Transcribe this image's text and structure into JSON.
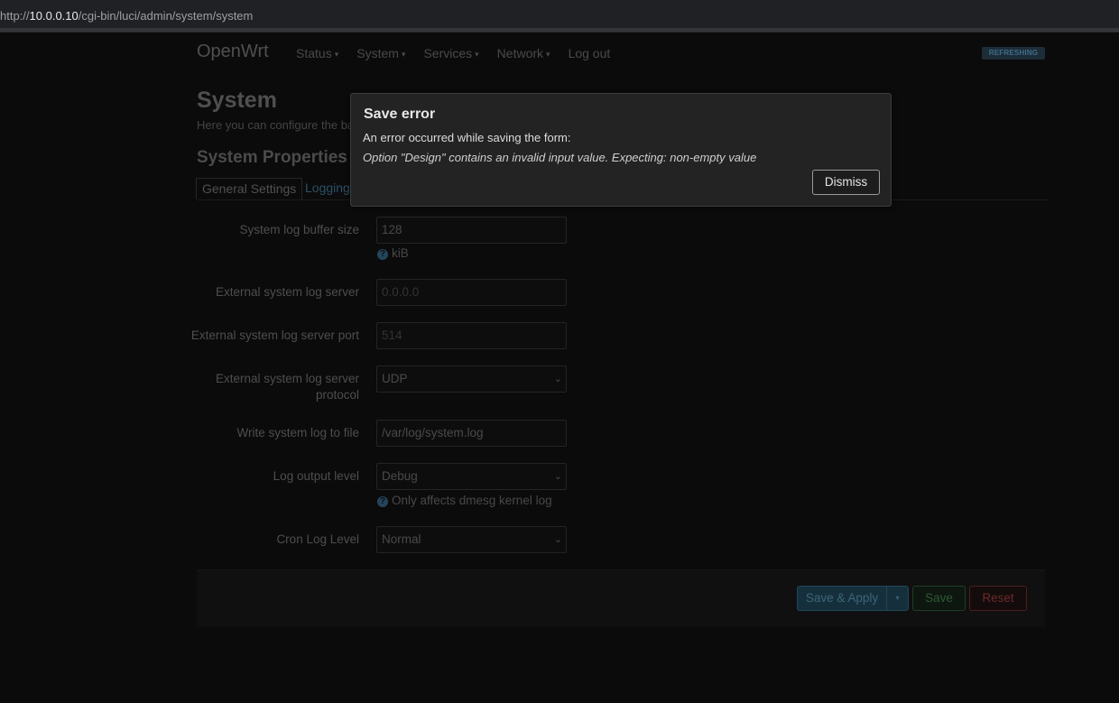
{
  "browser": {
    "url_prefix": "http://",
    "url_host": "10.0.0.10",
    "url_path": "/cgi-bin/luci/admin/system/system"
  },
  "nav": {
    "brand": "OpenWrt",
    "items": [
      {
        "label": "Status",
        "caret": "▾"
      },
      {
        "label": "System",
        "caret": "▾"
      },
      {
        "label": "Services",
        "caret": "▾"
      },
      {
        "label": "Network",
        "caret": "▾"
      },
      {
        "label": "Log out",
        "caret": ""
      }
    ],
    "indicator": "REFRESHING"
  },
  "page": {
    "title": "System",
    "description": "Here you can configure the ba",
    "section_title": "System Properties"
  },
  "tabs": [
    {
      "label": "General Settings",
      "active": false
    },
    {
      "label": "Logging",
      "active": true
    }
  ],
  "form": {
    "log_buffer_size": {
      "label": "System log buffer size",
      "value": "128",
      "help": "kiB"
    },
    "log_server": {
      "label": "External system log server",
      "placeholder": "0.0.0.0"
    },
    "log_server_port": {
      "label": "External system log server port",
      "placeholder": "514"
    },
    "log_server_protocol": {
      "label_line1": "External system log server",
      "label_line2": "protocol",
      "value": "UDP"
    },
    "log_file": {
      "label": "Write system log to file",
      "value": "/var/log/system.log"
    },
    "log_output_level": {
      "label": "Log output level",
      "value": "Debug",
      "help": "Only affects dmesg kernel log"
    },
    "cron_log_level": {
      "label": "Cron Log Level",
      "value": "Normal"
    }
  },
  "actions": {
    "save_apply": "Save & Apply",
    "dropdown": "▾",
    "save": "Save",
    "reset": "Reset"
  },
  "modal": {
    "title": "Save error",
    "message": "An error occurred while saving the form:",
    "detail": "Option \"Design\" contains an invalid input value. Expecting: non-empty value",
    "dismiss": "Dismiss"
  },
  "icons": {
    "help": "?",
    "select_chevron": "⌄"
  },
  "colors": {
    "modal_bg": "#232323",
    "accent_blue": "#1f4758",
    "save_green": "#1f3d24",
    "reset_red": "#4a1e1e"
  }
}
